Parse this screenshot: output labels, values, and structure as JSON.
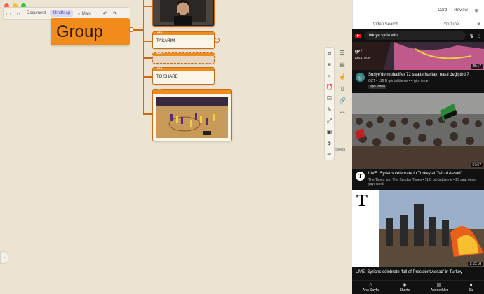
{
  "toolbar": {
    "document_label": "Document",
    "mindmap_label": "MindMap",
    "main_label": "Main"
  },
  "mindmap": {
    "group_title": "Group",
    "nodes": [
      "TASARIM",
      "",
      "TO SHARE"
    ]
  },
  "select_label": "Select",
  "panel": {
    "card_label": "Card",
    "review_label": "Review",
    "tab_video_search": "Video Search",
    "tab_youtube": "Youtube"
  },
  "youtube": {
    "search_query": "türkiye syria win",
    "videos": [
      {
        "duration": "25:17",
        "channel_badge": "g",
        "title": "Suriye'de muhalifler 72 saatte haritayı nasıl değiştirdi?",
        "meta": "GZT • 119 B görüntüleme • 4 gün önce",
        "chip": "İlgili video"
      },
      {
        "duration": "57:57",
        "channel_badge": "T",
        "title": "LIVE: Syrians celebrate in Turkey at \"fall of Assad\"",
        "meta": "The Times and The Sunday Times • 11 B görüntüleme • 23 saat önce yayınlandı"
      },
      {
        "duration": "1:15:18",
        "channel_badge": "T",
        "title": "LIVE: Syrians celebrate 'fall of President Assad' in Turkey",
        "meta": ""
      }
    ],
    "nav": [
      "Ana Sayfa",
      "Shorts",
      "Abonelikler",
      "Siz"
    ]
  }
}
